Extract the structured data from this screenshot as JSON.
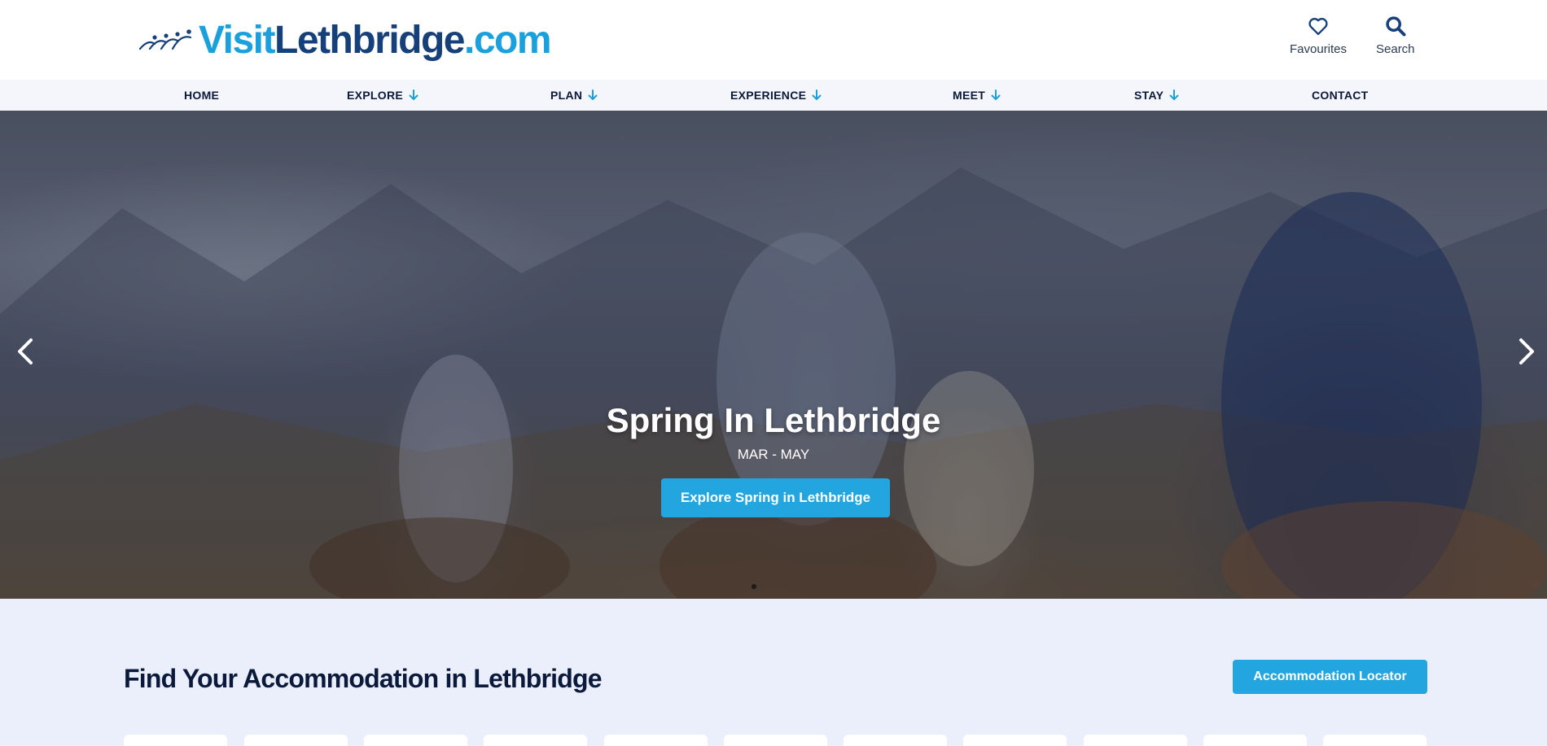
{
  "site": {
    "logo": {
      "visit": "Visit",
      "lethbridge": "Lethbridge",
      "com": ".com"
    }
  },
  "header": {
    "favourites_label": "Favourites",
    "search_label": "Search"
  },
  "nav": {
    "items": [
      {
        "label": "HOME",
        "has_dropdown": false
      },
      {
        "label": "EXPLORE",
        "has_dropdown": true
      },
      {
        "label": "PLAN",
        "has_dropdown": true
      },
      {
        "label": "EXPERIENCE",
        "has_dropdown": true
      },
      {
        "label": "MEET",
        "has_dropdown": true
      },
      {
        "label": "STAY",
        "has_dropdown": true
      },
      {
        "label": "CONTACT",
        "has_dropdown": false
      }
    ]
  },
  "hero": {
    "title": "Spring In Lethbridge",
    "subtitle": "MAR - MAY",
    "button_label": "Explore Spring in Lethbridge",
    "prev_icon": "chevron-left-icon",
    "next_icon": "chevron-right-icon"
  },
  "accommodation": {
    "title": "Find Your Accommodation in Lethbridge",
    "button_label": "Accommodation Locator"
  },
  "colors": {
    "brand_blue": "#1aa0dc",
    "brand_navy": "#16407a",
    "button": "#23a6e0",
    "nav_bg": "#f4f6fc",
    "section_bg": "#ebeffb",
    "text_dark": "#0b1a3a"
  },
  "icons": {
    "favourites": "heart-icon",
    "search": "search-icon",
    "dropdown": "arrow-down-icon"
  }
}
